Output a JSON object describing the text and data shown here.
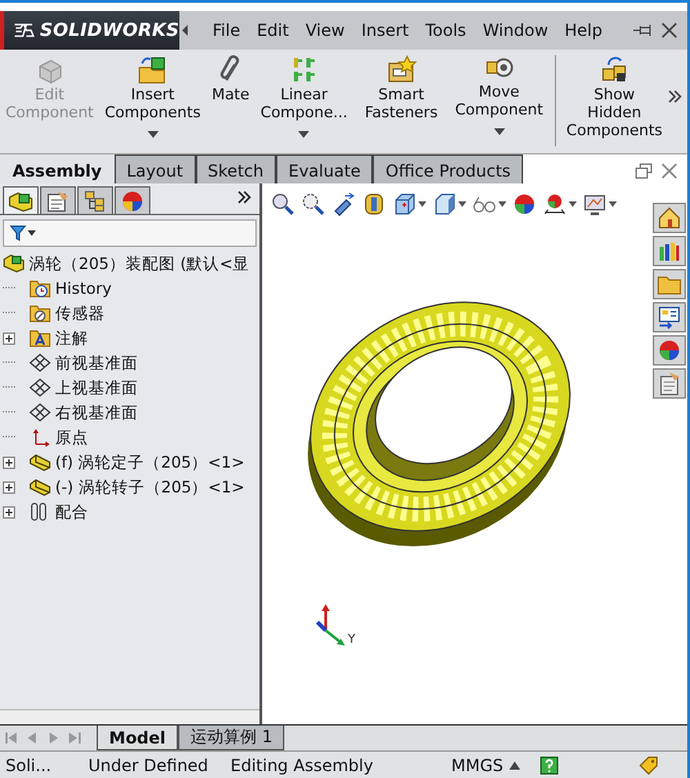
{
  "title_bar": {
    "logo": "SOLIDWORKS",
    "menu": [
      "File",
      "Edit",
      "View",
      "Insert",
      "Tools",
      "Window",
      "Help"
    ]
  },
  "ribbon": {
    "buttons": [
      {
        "label": "Edit Component",
        "disabled": true,
        "dropdown": false
      },
      {
        "label": "Insert Components",
        "disabled": false,
        "dropdown": true
      },
      {
        "label": "Mate",
        "disabled": false,
        "dropdown": false
      },
      {
        "label": "Linear Compone...",
        "disabled": false,
        "dropdown": true
      },
      {
        "label": "Smart Fasteners",
        "disabled": false,
        "dropdown": false
      },
      {
        "label": "Move Component",
        "disabled": false,
        "dropdown": true
      },
      {
        "label": "Show Hidden Components",
        "disabled": false,
        "dropdown": false
      }
    ]
  },
  "tabs": [
    {
      "label": "Assembly",
      "selected": true
    },
    {
      "label": "Layout",
      "selected": false
    },
    {
      "label": "Sketch",
      "selected": false
    },
    {
      "label": "Evaluate",
      "selected": false
    },
    {
      "label": "Office Products",
      "selected": false
    }
  ],
  "panel_tabs": [
    {
      "selected": true
    },
    {
      "selected": false
    },
    {
      "selected": false
    },
    {
      "selected": false
    }
  ],
  "tree": {
    "root": {
      "label": "涡轮（205）装配图 (默认<显",
      "kind": "assembly"
    },
    "items": [
      {
        "label": "History",
        "kind": "history",
        "collapsed": false
      },
      {
        "label": "传感器",
        "kind": "sensor",
        "collapsed": false
      },
      {
        "label": "注解",
        "kind": "annotation",
        "collapsed": true
      },
      {
        "label": "前视基准面",
        "kind": "plane",
        "collapsed": false
      },
      {
        "label": "上视基准面",
        "kind": "plane",
        "collapsed": false
      },
      {
        "label": "右视基准面",
        "kind": "plane",
        "collapsed": false
      },
      {
        "label": "原点",
        "kind": "origin",
        "collapsed": false
      },
      {
        "label": "(f) 涡轮定子（205）<1>",
        "kind": "part",
        "collapsed": true
      },
      {
        "label": "(-) 涡轮转子（205）<1>",
        "kind": "part",
        "collapsed": true
      },
      {
        "label": "配合",
        "kind": "mates",
        "collapsed": true
      }
    ]
  },
  "viewport": {
    "triad_label": "Y"
  },
  "bottom_tabs": [
    {
      "label": "Model",
      "selected": true
    },
    {
      "label": "运动算例 1",
      "selected": false
    }
  ],
  "status_bar": [
    "Soli...",
    "Under Defined",
    "Editing Assembly",
    "MMGS"
  ]
}
